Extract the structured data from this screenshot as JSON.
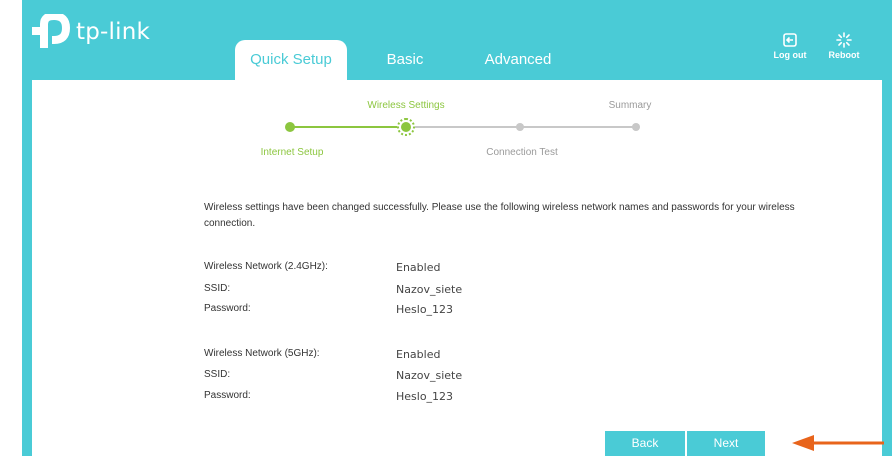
{
  "brand": {
    "name": "tp-link"
  },
  "tabs": [
    {
      "label": "Quick Setup",
      "active": true
    },
    {
      "label": "Basic",
      "active": false
    },
    {
      "label": "Advanced",
      "active": false
    }
  ],
  "header_actions": {
    "logout_label": "Log out",
    "reboot_label": "Reboot"
  },
  "wizard": {
    "steps": [
      {
        "label": "Internet Setup",
        "status": "done"
      },
      {
        "label": "Wireless Settings",
        "status": "current"
      },
      {
        "label": "Connection Test",
        "status": "pending"
      },
      {
        "label": "Summary",
        "status": "pending"
      }
    ]
  },
  "message": "Wireless settings have been changed successfully. Please use the following wireless network names and passwords for your wireless connection.",
  "networks": [
    {
      "band_label": "Wireless Network (2.4GHz):",
      "band_value": "Enabled",
      "ssid_label": "SSID:",
      "ssid_value": "Nazov_siete",
      "password_label": "Password:",
      "password_value": "Heslo_123"
    },
    {
      "band_label": "Wireless Network (5GHz):",
      "band_value": "Enabled",
      "ssid_label": "SSID:",
      "ssid_value": "Nazov_siete",
      "password_label": "Password:",
      "password_value": "Heslo_123"
    }
  ],
  "buttons": {
    "back": "Back",
    "next": "Next"
  },
  "colors": {
    "header": "#4acbd6",
    "step_done": "#8cc63f",
    "step_pending": "#c8c8c8",
    "annotation_arrow": "#e8641b"
  }
}
